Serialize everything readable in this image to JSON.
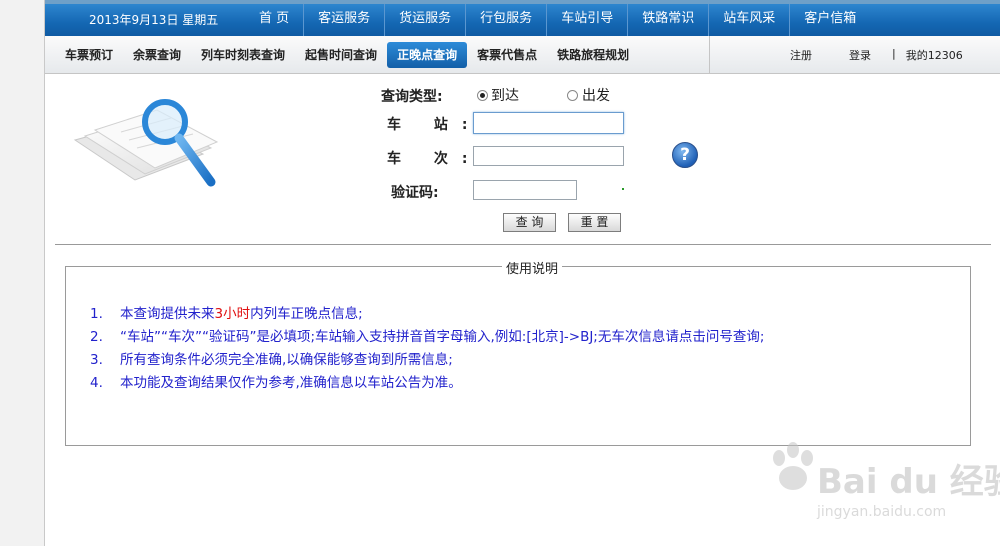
{
  "header": {
    "date": "2013年9月13日 星期五",
    "nav": [
      "首 页",
      "客运服务",
      "货运服务",
      "行包服务",
      "车站引导",
      "铁路常识",
      "站车风采",
      "客户信箱"
    ]
  },
  "subnav": {
    "tabs": [
      "车票预订",
      "余票查询",
      "列车时刻表查询",
      "起售时间查询",
      "正晚点查询",
      "客票代售点",
      "铁路旅程规划"
    ],
    "active": "正晚点查询",
    "register": "注册",
    "login": "登录",
    "divider": "|",
    "my12306": "我的12306"
  },
  "form": {
    "query_type_label": "查询类型:",
    "option_arrive": "到达",
    "option_depart": "出发",
    "selected": "到达",
    "station_label": "车 站:",
    "station_value": "",
    "train_label": "车 次:",
    "train_value": "",
    "captcha_label": "验证码:",
    "captcha_value": "",
    "search_button": "查 询",
    "reset_button": "重 置",
    "help_icon_text": "?"
  },
  "instructions": {
    "title": "使用说明",
    "items": [
      {
        "num": "1.",
        "before": "本查询提供未来",
        "highlight": "3小时",
        "after": "内列车正晚点信息;"
      },
      {
        "num": "2.",
        "text": "“车站”“车次”“验证码”是必填项;车站输入支持拼音首字母输入,例如:[北京]->BJ;无车次信息请点击问号查询;"
      },
      {
        "num": "3.",
        "text": "所有查询条件必须完全准确,以确保能够查询到所需信息;"
      },
      {
        "num": "4.",
        "text": "本功能及查询结果仅作为参考,准确信息以车站公告为准。"
      }
    ]
  },
  "watermark": {
    "brand": "Bai du 经验",
    "url": "jingyan.baidu.com"
  },
  "colors": {
    "nav_blue": "#1467b3",
    "active_tab": "#135fa8",
    "instruction_text": "#2222cc",
    "highlight_red": "#e01010"
  }
}
